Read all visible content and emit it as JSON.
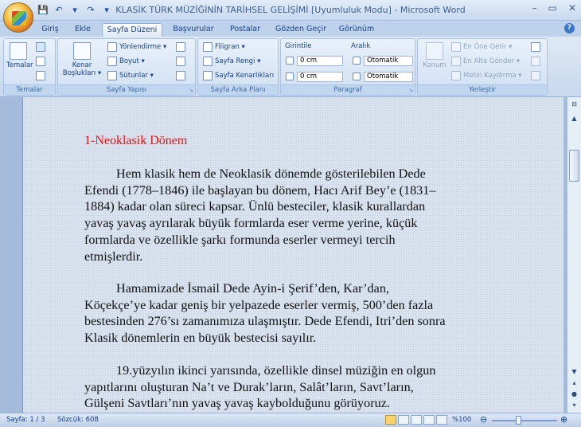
{
  "window": {
    "title": "KLASİK TÜRK MÜZİĞİNİN TARİHSEL GELİŞİMİ [Uyumluluk Modu] - Microsoft Word",
    "controls": [
      "–",
      "▭",
      "✕"
    ]
  },
  "qat": [
    "💾",
    "↶",
    "▾",
    "↷",
    "▾"
  ],
  "tabs": [
    "Giriş",
    "Ekle",
    "Sayfa Düzeni",
    "Başvurular",
    "Postalar",
    "Gözden Geçir",
    "Görünüm"
  ],
  "active_tab": "Sayfa Düzeni",
  "ribbon": {
    "temalar": {
      "label": "Temalar",
      "btn": "Temalar"
    },
    "sayfa_yapisi": {
      "label": "Sayfa Yapısı",
      "kenar_1": "Kenar",
      "kenar_2": "Boşlukları ▾",
      "yonlendirme": "Yönlendirme ▾",
      "boyut": "Boyut ▾",
      "sutunlar": "Sütunlar ▾"
    },
    "arka_plan": {
      "label": "Sayfa Arka Planı",
      "filigran": "Filigran ▾",
      "sayfa_rengi": "Sayfa Rengi ▾",
      "kenarliklar": "Sayfa Kenarlıkları"
    },
    "paragraf": {
      "label": "Paragraf",
      "girintile": "Girintile",
      "aralik": "Aralık",
      "sol": "0 cm",
      "sag": "0 cm",
      "once": "Otomatik",
      "sonra": "Otomatik"
    },
    "yerlestir": {
      "label": "Yerleştir",
      "konum": "Konum",
      "en_one": "En Öne Getir ▾",
      "en_alta": "En Alta Gönder ▾",
      "metin": "Metin Kaydırma ▾"
    }
  },
  "document": {
    "heading": "1-Neoklasik Dönem",
    "p1": [
      "Hem klasik hem de Neoklasik dönemde gösterilebilen Dede",
      "Efendi (1778–1846) ile başlayan bu dönem, Hacı Arif Bey’e (1831–",
      "1884) kadar olan süreci kapsar. Ünlü besteciler, klasik kurallardan",
      "yavaş yavaş ayrılarak büyük formlarda eser verme yerine, küçük",
      "formlarda ve özellikle şarkı formunda eserler vermeyi tercih",
      "etmişlerdir."
    ],
    "p2": [
      "Hamamizade İsmail Dede Ayin-i Şerif’den, Kar’dan,",
      "Köçekçe’ye kadar geniş bir yelpazede eserler vermiş, 500’den fazla",
      "bestesinden 276’sı zamanımıza ulaşmıştır. Dede Efendi, Itri’den sonra",
      "Klasik dönemlerin en büyük bestecisi sayılır."
    ],
    "p3": [
      "19.yüzyılın ikinci yarısında, özellikle dinsel müziğin en olgun",
      "yapıtlarını oluşturan Na’t ve Durak’ların, Salât’ların, Savt’ların,",
      "Gülşeni Savtları’nın yavaş yavaş kaybolduğunu görüyoruz."
    ]
  },
  "status": {
    "page": "Sayfa: 1 / 3",
    "words": "Sözcük: 608",
    "zoom": "%100",
    "zoom_level_percent": 100
  }
}
